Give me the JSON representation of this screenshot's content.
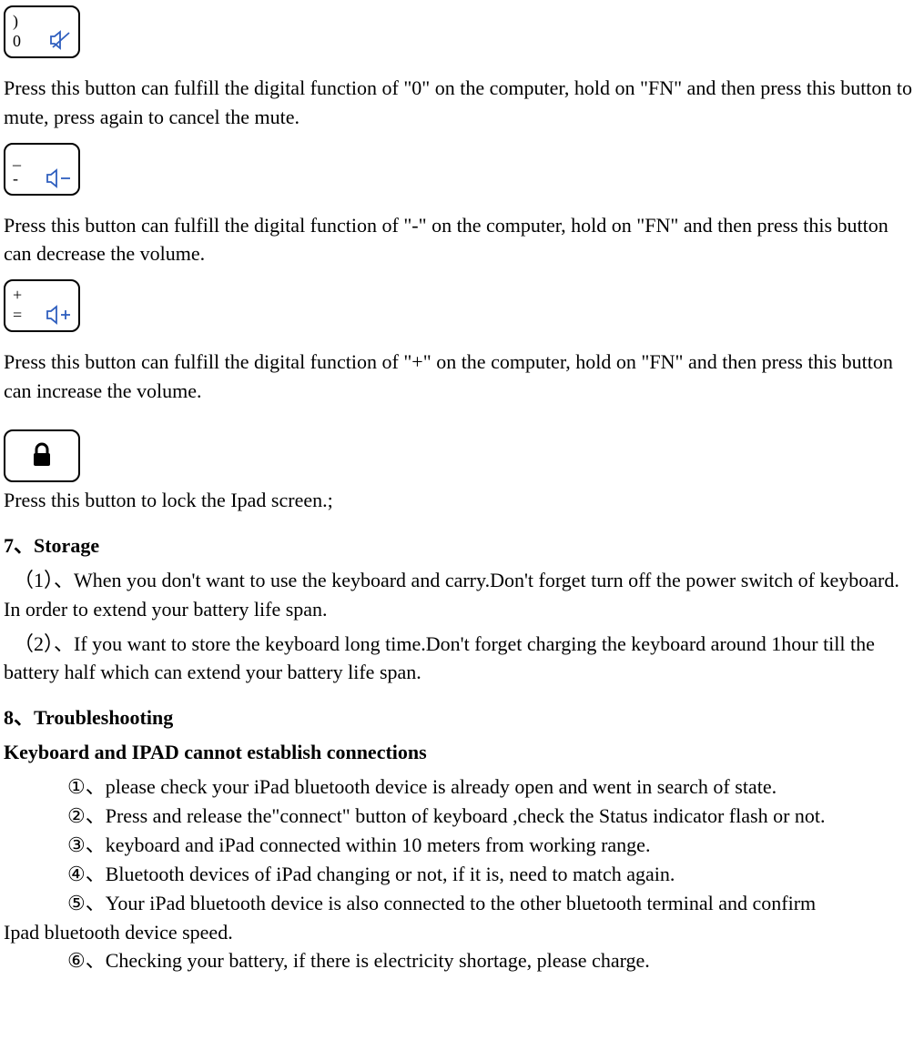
{
  "keys": {
    "zero": {
      "top": ")",
      "bottom": "0"
    },
    "minus": {
      "top": "_",
      "bottom": "-"
    },
    "plus": {
      "top": "+",
      "bottom": "="
    }
  },
  "para": {
    "zero": "Press this button can fulfill the digital function of \"0\" on the computer, hold on \"FN\" and then press this button to mute, press again to cancel the mute.",
    "minus": "Press this button can fulfill the digital function of \"-\" on the computer, hold on \"FN\" and then press this button can decrease the volume.",
    "plus": "Press this button can fulfill the digital function of \"+\" on the computer, hold on \"FN\" and then press this button can increase the volume.",
    "lock": "Press this button to lock the Ipad screen.;"
  },
  "section7": {
    "title": "7、Storage",
    "item1_lead": "（1）、",
    "item1_text": "When you don't want to use the keyboard and carry.Don't forget turn off the power switch of keyboard. In order to extend your battery life span.",
    "item2_lead": "（2）、",
    "item2_text": "If you want to store the keyboard long time.Don't forget charging the keyboard around 1hour till the battery half which can extend your battery life span."
  },
  "section8": {
    "title": "8、Troubleshooting",
    "subtitle": "Keyboard and IPAD cannot establish connections",
    "items": [
      {
        "num": "①、",
        "text": "please check your iPad bluetooth device is already open and went in search of state."
      },
      {
        "num": "②、",
        "text": "Press and release the\"connect\" button of keyboard ,check the Status indicator flash or not."
      },
      {
        "num": "③、",
        "text": "keyboard and iPad connected within 10 meters from working range."
      },
      {
        "num": "④、",
        "text": "Bluetooth devices of iPad changing or not, if it is, need to match again."
      },
      {
        "num": "⑤、",
        "text": "Your iPad bluetooth device is also connected to the other bluetooth terminal and confirm Ipad bluetooth device speed."
      },
      {
        "num": "⑥、",
        "text": "Checking your battery, if there is electricity shortage, please charge."
      }
    ]
  }
}
